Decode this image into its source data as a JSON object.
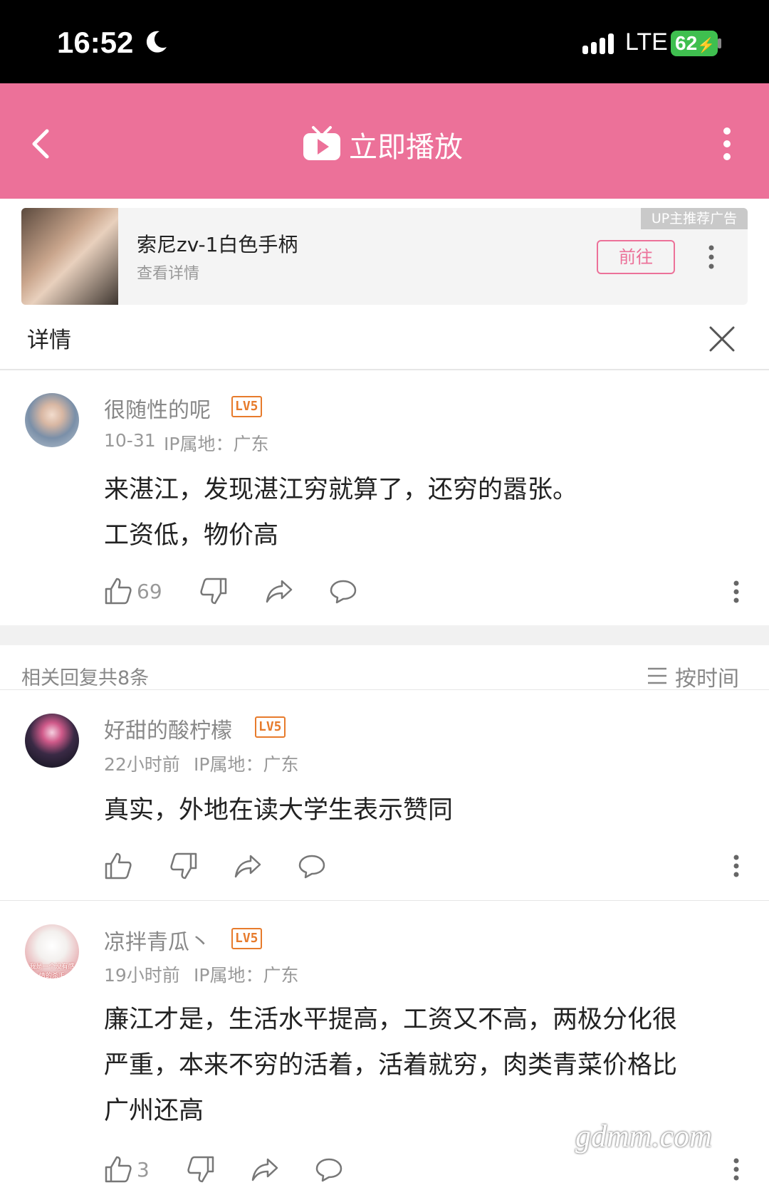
{
  "status_bar": {
    "time": "16:52",
    "network": "LTE",
    "battery": "62"
  },
  "header": {
    "title": "立即播放"
  },
  "ad": {
    "badge": "UP主推荐广告",
    "title": "索尼zv-1白色手柄",
    "subtitle": "查看详情",
    "go_label": "前往"
  },
  "detail": {
    "label": "详情"
  },
  "main_comment": {
    "user": "很随性的呢",
    "level": "LV5",
    "date": "10-31",
    "ip": "IP属地：广东",
    "lines": [
      "来湛江，发现湛江穷就算了，还穷的嚣张。",
      "工资低，物价高"
    ],
    "likes": "69"
  },
  "replies_header": {
    "label": "相关回复共8条",
    "sort_label": "按时间"
  },
  "replies": [
    {
      "user": "好甜的酸柠檬",
      "level": "LV5",
      "date": "22小时前",
      "ip": "IP属地：广东",
      "lines": [
        "真实，外地在读大学生表示赞同"
      ],
      "likes": ""
    },
    {
      "user": "凉拌青瓜丶",
      "level": "LV5",
      "date": "19小时前",
      "ip": "IP属地：广东",
      "lines": [
        "廉江才是，生活水平提高，工资又不高，两极分化很",
        "严重，本来不穷的活着，活着就穷，肉类青菜价格比",
        "广州还高"
      ],
      "likes": "3",
      "avatar_text": "我是一个没有感情的杀手"
    }
  ],
  "watermark": "gdmm.com",
  "colors": {
    "header": "#ec7199",
    "level_badge": "#e77b2c"
  }
}
